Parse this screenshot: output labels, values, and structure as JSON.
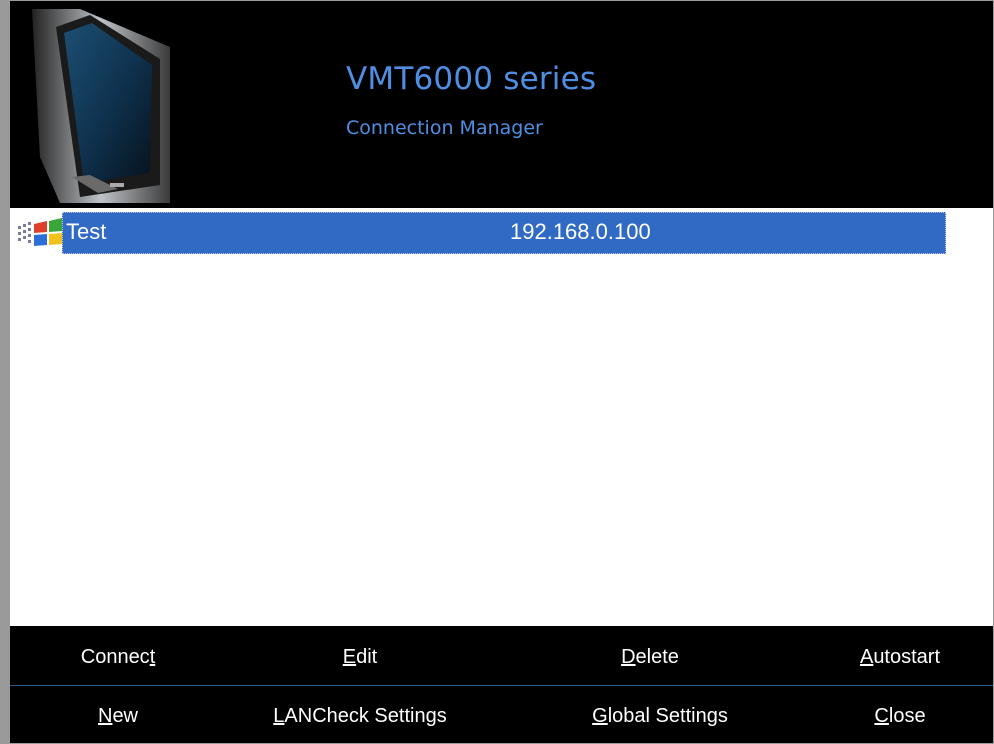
{
  "header": {
    "title": "VMT6000 series",
    "subtitle": "Connection Manager"
  },
  "connections": [
    {
      "name": "Test",
      "address": "192.168.0.100",
      "selected": true
    }
  ],
  "buttons": {
    "row1": [
      {
        "pre": "Connec",
        "key": "t",
        "post": ""
      },
      {
        "pre": "",
        "key": "E",
        "post": "dit"
      },
      {
        "pre": "",
        "key": "D",
        "post": "elete"
      },
      {
        "pre": "",
        "key": "A",
        "post": "utostart"
      }
    ],
    "row2": [
      {
        "pre": "",
        "key": "N",
        "post": "ew"
      },
      {
        "pre": "",
        "key": "L",
        "post": "ANCheck Settings"
      },
      {
        "pre": "",
        "key": "G",
        "post": "lobal Settings"
      },
      {
        "pre": "",
        "key": "C",
        "post": "lose"
      }
    ]
  },
  "colors": {
    "accent": "#4f8fe3",
    "selection": "#316ac5",
    "background": "#000000"
  }
}
